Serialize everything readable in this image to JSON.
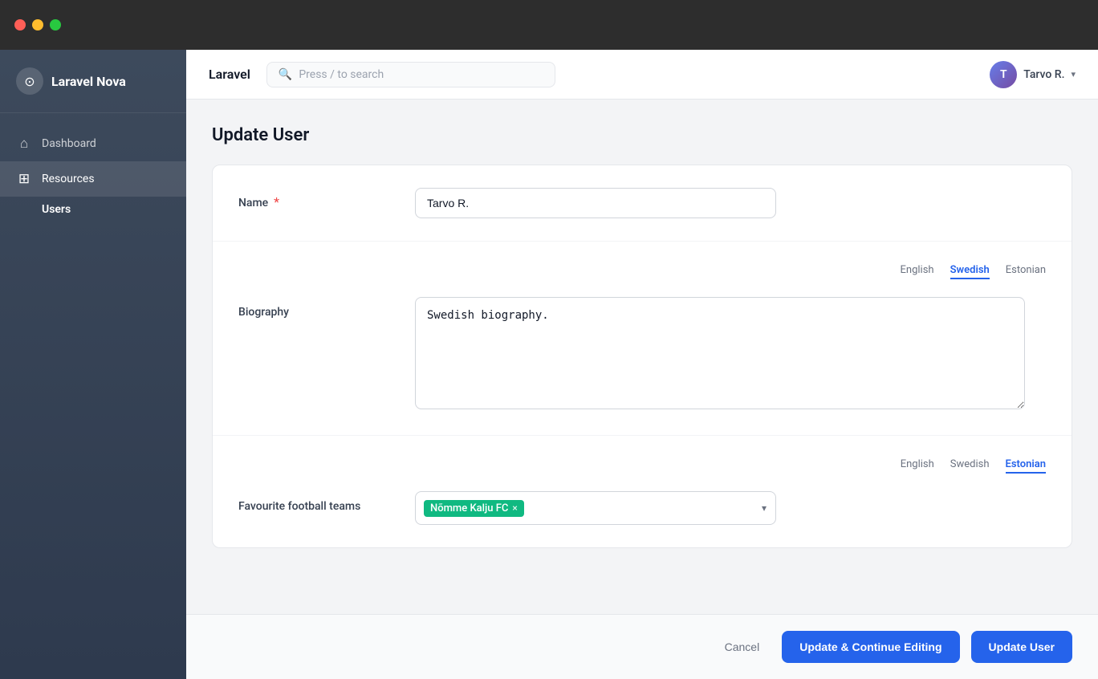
{
  "window": {
    "title": "Laravel Nova"
  },
  "titlebar": {
    "close_label": "close",
    "minimize_label": "minimize",
    "maximize_label": "maximize"
  },
  "sidebar": {
    "brand": "Laravel Nova",
    "brand_bold": "Laravel",
    "brand_regular": " Nova",
    "nav_items": [
      {
        "id": "dashboard",
        "label": "Dashboard",
        "icon": "⌂"
      },
      {
        "id": "resources",
        "label": "Resources",
        "icon": "⊞"
      }
    ],
    "sub_items": [
      {
        "id": "users",
        "label": "Users"
      }
    ]
  },
  "header": {
    "title": "Laravel",
    "search_placeholder": "Press / to search",
    "user_name": "Tarvo R.",
    "user_initial": "T"
  },
  "page": {
    "title": "Update User"
  },
  "form": {
    "name_label": "Name",
    "name_required": true,
    "name_value": "Tarvo R.",
    "biography_label": "Biography",
    "biography_value": "Swedish biography.",
    "biography_placeholder": "",
    "football_label": "Favourite football teams",
    "football_tag": "Nõmme Kalju FC",
    "lang_tabs_bio": [
      {
        "id": "english",
        "label": "English",
        "active": false
      },
      {
        "id": "swedish",
        "label": "Swedish",
        "active": true
      },
      {
        "id": "estonian",
        "label": "Estonian",
        "active": false
      }
    ],
    "lang_tabs_football": [
      {
        "id": "english",
        "label": "English",
        "active": false
      },
      {
        "id": "swedish",
        "label": "Swedish",
        "active": false
      },
      {
        "id": "estonian",
        "label": "Estonian",
        "active": true
      }
    ]
  },
  "actions": {
    "cancel_label": "Cancel",
    "update_continue_label": "Update & Continue Editing",
    "update_label": "Update User"
  }
}
